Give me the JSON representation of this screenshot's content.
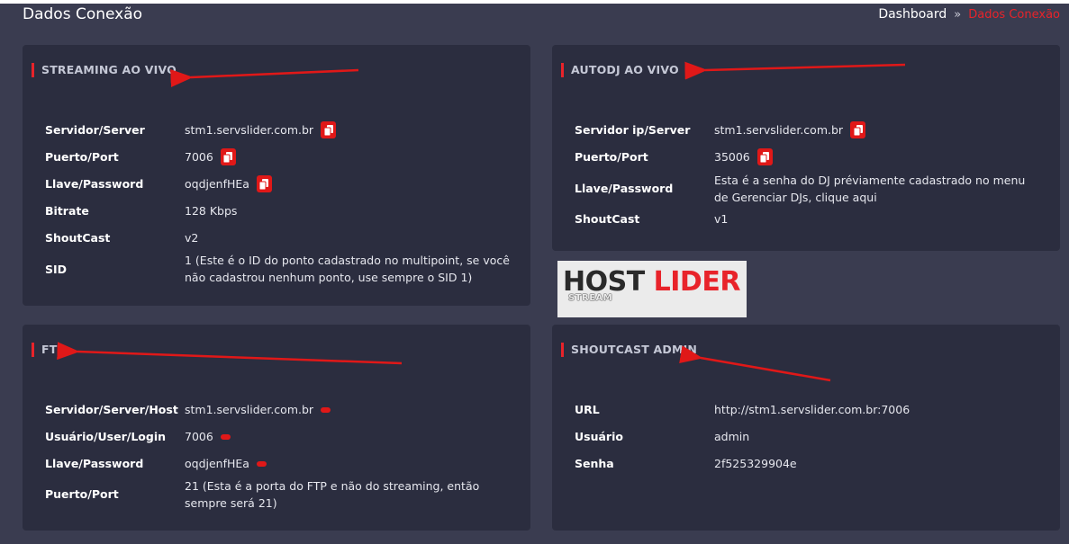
{
  "header": {
    "title": "Dados Conexão",
    "breadcrumb": {
      "link": "Dashboard",
      "separator": "»",
      "active": "Dados Conexão"
    }
  },
  "streaming": {
    "title": "STREAMING AO VIVO",
    "rows": [
      {
        "label": "Servidor/Server",
        "value": "stm1.servslider.com.br"
      },
      {
        "label": "Puerto/Port",
        "value": "7006"
      },
      {
        "label": "Llave/Password",
        "value": "oqdjenfHEa"
      },
      {
        "label": "Bitrate",
        "value": "128 Kbps"
      },
      {
        "label": "ShoutCast",
        "value": "v2"
      },
      {
        "label": "SID",
        "value": "1 (Este é o ID do ponto cadastrado no multipoint, se você não cadastrou nenhum ponto, use sempre o SID 1)"
      }
    ]
  },
  "autodj": {
    "title": "AUTODJ AO VIVO",
    "rows": [
      {
        "label": "Servidor ip/Server",
        "value": "stm1.servslider.com.br"
      },
      {
        "label": "Puerto/Port",
        "value": "35006"
      },
      {
        "label": "Llave/Password",
        "value": "Esta é a senha do DJ préviamente cadastrado no menu de Gerenciar DJs, clique aqui"
      },
      {
        "label": "ShoutCast",
        "value": "v1"
      }
    ]
  },
  "ftp": {
    "title": "FTP",
    "rows": [
      {
        "label": "Servidor/Server/Host",
        "value": "stm1.servslider.com.br"
      },
      {
        "label": "Usuário/User/Login",
        "value": "7006"
      },
      {
        "label": "Llave/Password",
        "value": "oqdjenfHEa"
      },
      {
        "label": "Puerto/Port",
        "value": "21 (Esta é a porta do FTP e não do streaming, então sempre será 21)"
      }
    ]
  },
  "shoutcast_admin": {
    "title": "SHOUTCAST ADMIN",
    "rows": [
      {
        "label": "URL",
        "value": "http://stm1.servslider.com.br:7006"
      },
      {
        "label": "Usuário",
        "value": "admin"
      },
      {
        "label": "Senha",
        "value": "2f525329904e"
      }
    ]
  },
  "logo": {
    "host": "HOST",
    "lider": "LIDER",
    "stream": "STREAM"
  },
  "colors": {
    "accent": "#e8232a",
    "card": "#2b2d3f",
    "background": "#3a3c50"
  },
  "icons": {
    "copy": "copy-icon"
  }
}
